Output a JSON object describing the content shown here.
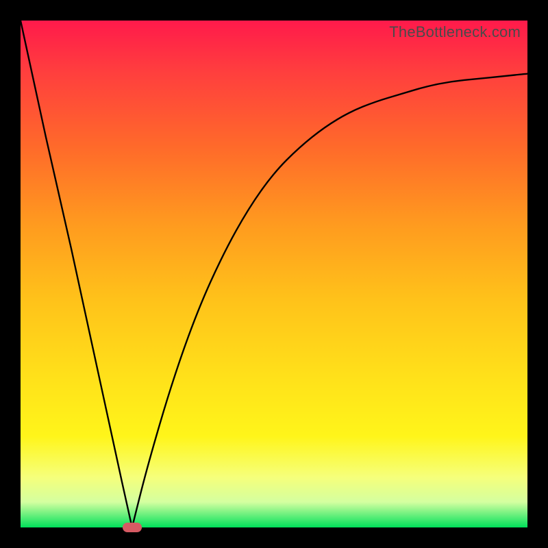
{
  "watermark": "TheBottleneck.com",
  "colors": {
    "marker": "#d65a63",
    "curve": "#000000"
  },
  "chart_data": {
    "type": "line",
    "title": "",
    "xlabel": "",
    "ylabel": "",
    "xlim": [
      0,
      100
    ],
    "ylim": [
      0,
      100
    ],
    "grid": false,
    "legend": false,
    "note": "Rainbow vertical gradient background (red top → green bottom). Single black V-shaped curve with minimum near x≈22. Small rounded pink marker at the minimum on the x-axis.",
    "series": [
      {
        "name": "left-branch",
        "x": [
          0,
          5,
          10,
          15,
          20,
          22
        ],
        "y": [
          100,
          77,
          55,
          32,
          9,
          0
        ]
      },
      {
        "name": "right-branch",
        "x": [
          22,
          25,
          30,
          35,
          40,
          45,
          50,
          55,
          60,
          65,
          70,
          75,
          80,
          85,
          90,
          95,
          100
        ],
        "y": [
          0,
          12,
          29,
          43,
          54,
          63,
          70,
          75,
          79,
          82,
          84,
          85.5,
          87,
          88,
          88.5,
          89,
          89.5
        ]
      }
    ],
    "marker": {
      "x": 22,
      "y": 0
    }
  }
}
